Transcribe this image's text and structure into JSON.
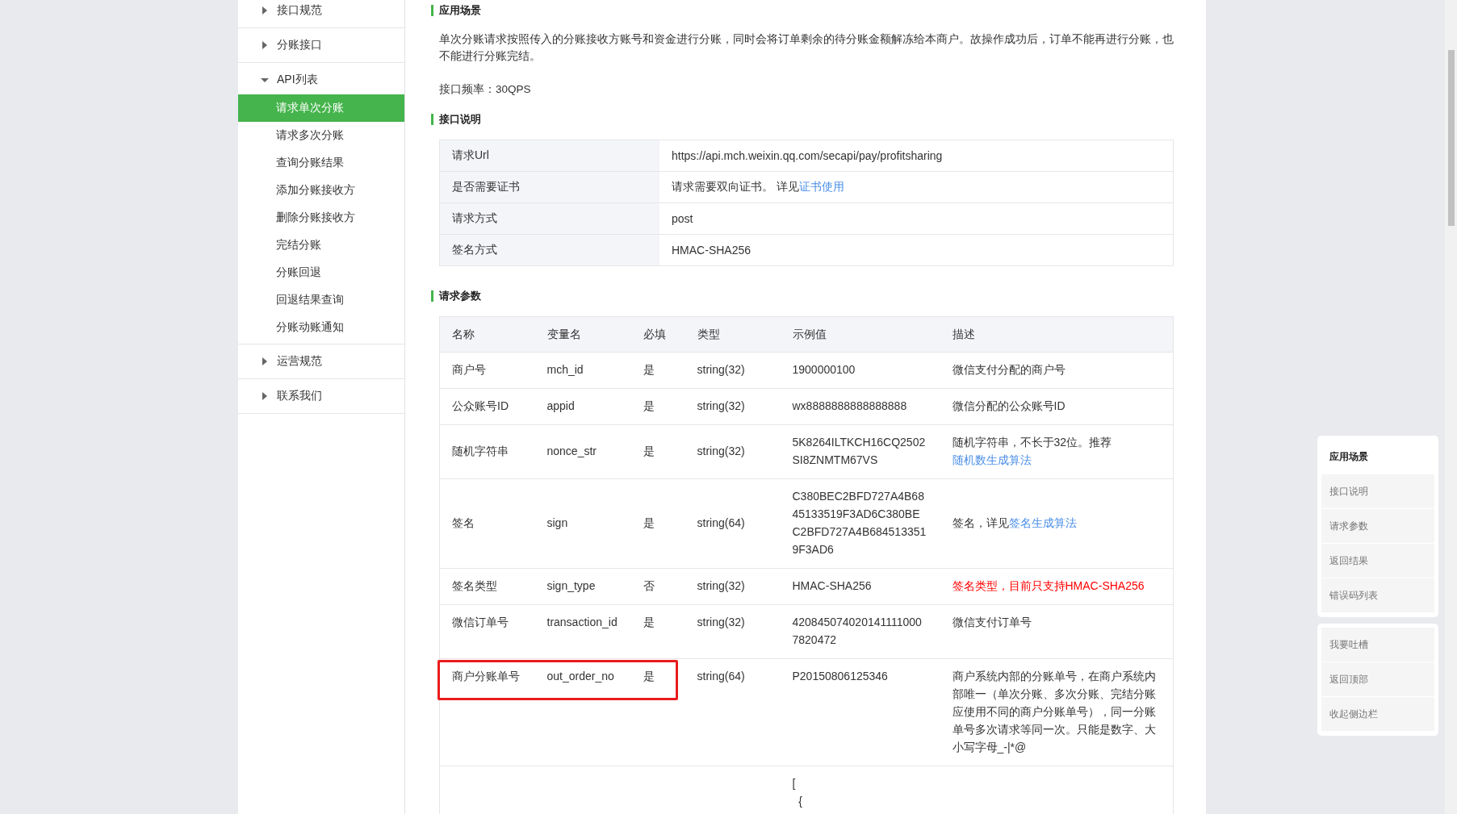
{
  "sidebar": {
    "items": [
      {
        "label": "接口规范",
        "expanded": false
      },
      {
        "label": "分账接口",
        "expanded": false
      },
      {
        "label": "API列表",
        "expanded": true,
        "children": [
          {
            "label": "请求单次分账",
            "selected": true
          },
          {
            "label": "请求多次分账",
            "selected": false
          },
          {
            "label": "查询分账结果",
            "selected": false
          },
          {
            "label": "添加分账接收方",
            "selected": false
          },
          {
            "label": "删除分账接收方",
            "selected": false
          },
          {
            "label": "完结分账",
            "selected": false
          },
          {
            "label": "分账回退",
            "selected": false
          },
          {
            "label": "回退结果查询",
            "selected": false
          },
          {
            "label": "分账动账通知",
            "selected": false
          }
        ]
      },
      {
        "label": "运营规范",
        "expanded": false
      },
      {
        "label": "联系我们",
        "expanded": false
      }
    ]
  },
  "scenario": {
    "heading": "应用场景",
    "paragraphs": [
      "单次分账请求按照传入的分账接收方账号和资金进行分账，同时会将订单剩余的待分账金额解冻给本商户。故操作成功后，订单不能再进行分账，也不能进行分账完结。",
      "接口频率：30QPS"
    ]
  },
  "interface": {
    "heading": "接口说明",
    "rows": [
      {
        "label": "请求Url",
        "value": "https://api.mch.weixin.qq.com/secapi/pay/profitsharing",
        "link": ""
      },
      {
        "label": "是否需要证书",
        "value": "请求需要双向证书。 详见",
        "link": "证书使用"
      },
      {
        "label": "请求方式",
        "value": "post",
        "link": ""
      },
      {
        "label": "签名方式",
        "value": "HMAC-SHA256",
        "link": ""
      }
    ]
  },
  "params": {
    "heading": "请求参数",
    "columns": [
      "名称",
      "变量名",
      "必填",
      "类型",
      "示例值",
      "描述"
    ],
    "rows": [
      {
        "name": "商户号",
        "variable": "mch_id",
        "required": "是",
        "type": "string(32)",
        "example": "1900000100",
        "description": "微信支付分配的商户号",
        "link": "",
        "alert": false,
        "highlighted": false
      },
      {
        "name": "公众账号ID",
        "variable": "appid",
        "required": "是",
        "type": "string(32)",
        "example": "wx8888888888888888",
        "description": "微信分配的公众账号ID",
        "link": "",
        "alert": false,
        "highlighted": false
      },
      {
        "name": "随机字符串",
        "variable": "nonce_str",
        "required": "是",
        "type": "string(32)",
        "example": "5K8264ILTKCH16CQ2502SI8ZNMTM67VS",
        "description": "随机字符串，不长于32位。推荐",
        "link": "随机数生成算法",
        "alert": false,
        "highlighted": false
      },
      {
        "name": "签名",
        "variable": "sign",
        "required": "是",
        "type": "string(64)",
        "example": "C380BEC2BFD727A4B6845133519F3AD6C380BEC2BFD727A4B6845133519F3AD6",
        "description": "签名，详见",
        "link": "签名生成算法",
        "alert": false,
        "highlighted": false
      },
      {
        "name": "签名类型",
        "variable": "sign_type",
        "required": "否",
        "type": "string(32)",
        "example": "HMAC-SHA256",
        "description": "签名类型，目前只支持HMAC-SHA256",
        "link": "",
        "alert": true,
        "highlighted": false
      },
      {
        "name": "微信订单号",
        "variable": "transaction_id",
        "required": "是",
        "type": "string(32)",
        "example": "4208450740201411110007820472",
        "description": "微信支付订单号",
        "link": "",
        "alert": false,
        "highlighted": false
      },
      {
        "name": "商户分账单号",
        "variable": "out_order_no",
        "required": "是",
        "type": "string(64)",
        "example": "P20150806125346",
        "description": "商户系统内部的分账单号，在商户系统内部唯一（单次分账、多次分账、完结分账应使用不同的商户分账单号），同一分账单号多次请求等同一次。只能是数字、大小写字母_-|*@",
        "link": "",
        "alert": false,
        "highlighted": true
      },
      {
        "name": "",
        "variable": "",
        "required": "",
        "type": "",
        "example": "[\n  {",
        "description": "",
        "link": ""
      }
    ]
  },
  "toc": {
    "sections": [
      {
        "label": "应用场景",
        "selected": true
      },
      {
        "label": "接口说明",
        "selected": false
      },
      {
        "label": "请求参数",
        "selected": false
      },
      {
        "label": "返回结果",
        "selected": false
      },
      {
        "label": "错误码列表",
        "selected": false
      }
    ],
    "actions": [
      "我要吐槽",
      "返回顶部",
      "收起侧边栏"
    ]
  }
}
